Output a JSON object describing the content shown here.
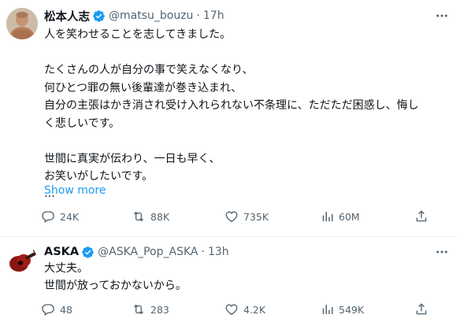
{
  "post1": {
    "name": "松本人志",
    "handle": "@matsu_bouzu",
    "dot": "·",
    "time": "17h",
    "lines": [
      "人を笑わせることを志してきました。",
      "",
      "たくさんの人が自分の事で笑えなくなり、",
      "何ひとつ罪の無い後輩達が巻き込まれ、",
      "自分の主張はかき消され受け入れられない不条理に、ただただ困惑し、悔し",
      "く悲しいです。",
      "",
      "世間に真実が伝わり、一日も早く、",
      "お笑いがしたいです。",
      "…"
    ],
    "show_more": "Show more",
    "replies": "24K",
    "reposts": "88K",
    "likes": "735K",
    "views": "60M"
  },
  "post2": {
    "name": "ASKA",
    "handle": "@ASKA_Pop_ASKA",
    "dot": "·",
    "time": "13h",
    "lines": [
      "大丈夫。",
      "世間が放っておかないから。"
    ],
    "replies": "48",
    "reposts": "283",
    "likes": "4.2K",
    "views": "549K"
  },
  "colors": {
    "verified": "#1d9bf0",
    "link": "#1d9bf0",
    "muted": "#536471"
  },
  "icons": {
    "reply": "reply-icon",
    "repost": "repost-icon",
    "like": "heart-icon",
    "views": "views-icon",
    "share": "share-icon",
    "more": "more-icon",
    "verified": "verified-badge-icon"
  }
}
